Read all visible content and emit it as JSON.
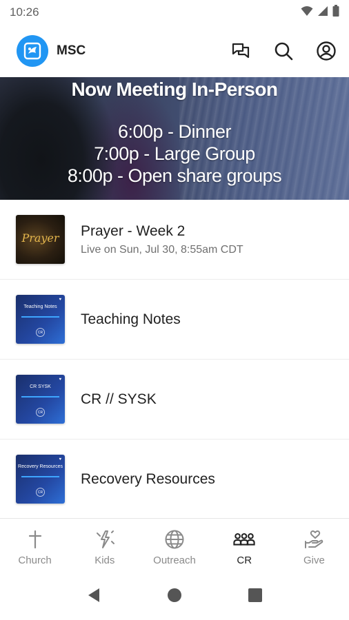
{
  "status_bar": {
    "time": "10:26",
    "icons": [
      "wifi-icon",
      "signal-icon",
      "battery-icon"
    ]
  },
  "app_bar": {
    "logo_icon": "church-logo-icon",
    "title": "MSC",
    "actions": [
      "chat-icon",
      "search-icon",
      "account-icon"
    ]
  },
  "banner": {
    "heading": "Now Meeting In-Person",
    "lines": [
      "6:00p - Dinner",
      "7:00p - Large Group",
      "8:00p - Open share groups"
    ]
  },
  "list": {
    "items": [
      {
        "title": "Prayer - Week 2",
        "subtitle": "Live on Sun, Jul 30, 8:55am CDT",
        "thumb_text": "Prayer"
      },
      {
        "title": "Teaching Notes",
        "thumb_text": "Teaching Notes",
        "thumb_badge": "CR"
      },
      {
        "title": "CR // SYSK",
        "thumb_text": "CR SYSK",
        "thumb_badge": "CR"
      },
      {
        "title": "Recovery Resources",
        "thumb_text": "Recovery Resources",
        "thumb_badge": "CR"
      }
    ]
  },
  "bottom_nav": {
    "items": [
      {
        "label": "Church",
        "icon": "cross-icon"
      },
      {
        "label": "Kids",
        "icon": "kids-icon"
      },
      {
        "label": "Outreach",
        "icon": "globe-icon"
      },
      {
        "label": "CR",
        "icon": "group-icon"
      },
      {
        "label": "Give",
        "icon": "give-icon"
      }
    ],
    "active": "CR"
  },
  "colors": {
    "accent": "#2196f3",
    "thumb_blue": "#2448a3",
    "inactive_nav": "#8a8a8a"
  }
}
